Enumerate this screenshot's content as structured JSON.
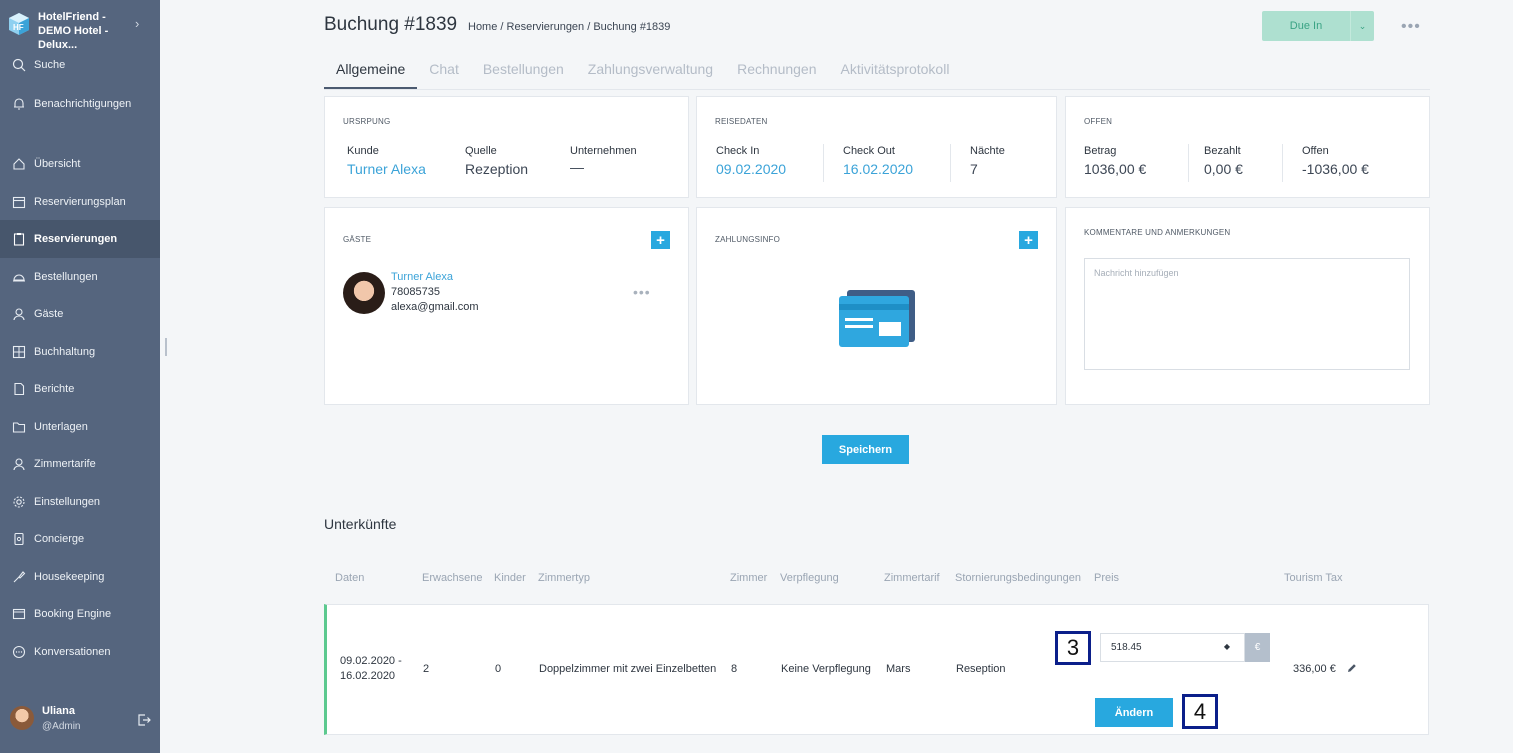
{
  "sidebar": {
    "brand": "HotelFriend - DEMO Hotel - Delux...",
    "items": [
      {
        "label": "Suche",
        "icon": "search-icon"
      },
      {
        "label": "Benachrichtigungen",
        "icon": "bell-icon"
      },
      {
        "label": "Übersicht",
        "icon": "home-icon"
      },
      {
        "label": "Reservierungsplan",
        "icon": "calendar-icon"
      },
      {
        "label": "Reservierungen",
        "icon": "clipboard-icon"
      },
      {
        "label": "Bestellungen",
        "icon": "cloche-icon"
      },
      {
        "label": "Gäste",
        "icon": "user-icon"
      },
      {
        "label": "Buchhaltung",
        "icon": "calculator-icon"
      },
      {
        "label": "Berichte",
        "icon": "report-icon"
      },
      {
        "label": "Unterlagen",
        "icon": "folder-icon"
      },
      {
        "label": "Zimmertarife",
        "icon": "tariff-icon"
      },
      {
        "label": "Einstellungen",
        "icon": "gear-icon"
      },
      {
        "label": "Concierge",
        "icon": "concierge-icon"
      },
      {
        "label": "Housekeeping",
        "icon": "housekeeping-icon"
      },
      {
        "label": "Booking Engine",
        "icon": "booking-engine-icon"
      },
      {
        "label": "Konversationen",
        "icon": "chat-icon"
      }
    ],
    "user": {
      "name": "Uliana",
      "role": "@Admin"
    }
  },
  "header": {
    "title": "Buchung #1839",
    "breadcrumb": "Home / Reservierungen / Buchung #1839",
    "status": "Due In"
  },
  "tabs": [
    "Allgemeine",
    "Chat",
    "Bestellungen",
    "Zahlungsverwaltung",
    "Rechnungen",
    "Aktivitätsprotokoll"
  ],
  "origin": {
    "title": "URSRPUNG",
    "customer_label": "Kunde",
    "customer": "Turner Alexa",
    "source_label": "Quelle",
    "source": "Rezeption",
    "company_label": "Unternehmen",
    "company": "—"
  },
  "travel": {
    "title": "REISEDATEN",
    "checkin_label": "Check In",
    "checkin": "09.02.2020",
    "checkout_label": "Check Out",
    "checkout": "16.02.2020",
    "nights_label": "Nächte",
    "nights": "7"
  },
  "open": {
    "title": "OFFEN",
    "amount_label": "Betrag",
    "amount": "1036,00 €",
    "paid_label": "Bezahlt",
    "paid": "0,00 €",
    "open_label": "Offen",
    "open_value": "-1036,00 €"
  },
  "guests": {
    "title": "GÄSTE",
    "guest": {
      "name": "Turner Alexa",
      "phone": "78085735",
      "email": "alexa@gmail.com"
    }
  },
  "payment": {
    "title": "ZAHLUNGSINFO"
  },
  "comments": {
    "title": "KOMMENTARE UND ANMERKUNGEN",
    "placeholder": "Nachricht hinzufügen"
  },
  "save_label": "Speichern",
  "accommodations": {
    "title": "Unterkünfte",
    "headers": [
      "Daten",
      "Erwachsene",
      "Kinder",
      "Zimmertyp",
      "Zimmer",
      "Verpflegung",
      "Zimmertarif",
      "Stornierungsbedingungen",
      "Preis",
      "Tourism Tax"
    ],
    "row": {
      "dates_line1": "09.02.2020 -",
      "dates_line2": "16.02.2020",
      "adults": "2",
      "children": "0",
      "room_type": "Doppelzimmer mit zwei Einzelbetten",
      "room": "8",
      "board": "Keine Verpflegung",
      "rate": "Mars",
      "cancellation": "Reseption",
      "price_value": "518.45",
      "currency": "€",
      "tourism_tax": "336,00 €"
    },
    "change_label": "Ändern",
    "marker_price": "3",
    "marker_change": "4"
  },
  "colors": {
    "sidebar": "#55657e",
    "accent": "#28a8df",
    "status_bg": "#aee0d0",
    "row_accent": "#5cc98f",
    "marker_border": "#0b1f8a"
  }
}
